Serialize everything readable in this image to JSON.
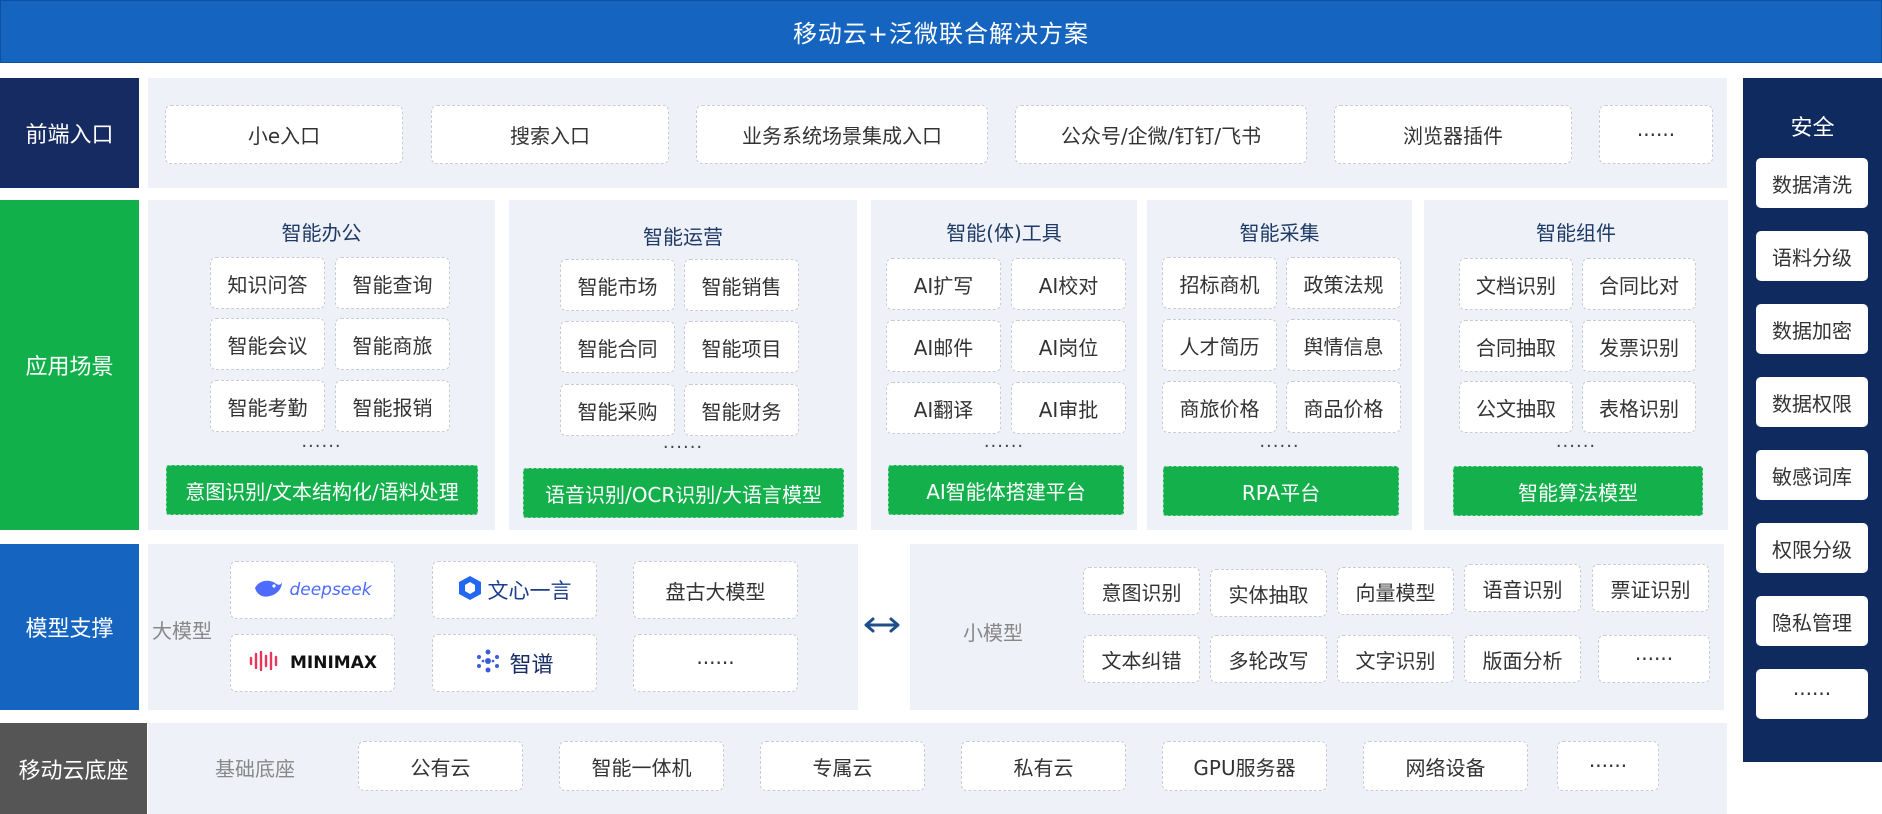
{
  "title": "移动云+泛微联合解决方案",
  "rows": {
    "frontend": {
      "label": "前端入口",
      "items": [
        "小e入口",
        "搜索入口",
        "业务系统场景集成入口",
        "公众号/企微/钉钉/飞书",
        "浏览器插件",
        "······"
      ]
    },
    "app": {
      "label": "应用场景",
      "groups": [
        {
          "title": "智能办公",
          "items": [
            "知识问答",
            "智能查询",
            "智能会议",
            "智能商旅",
            "智能考勤",
            "智能报销"
          ],
          "more": "······",
          "platform": "意图识别/文本结构化/语料处理"
        },
        {
          "title": "智能运营",
          "items": [
            "智能市场",
            "智能销售",
            "智能合同",
            "智能项目",
            "智能采购",
            "智能财务"
          ],
          "more": "······",
          "platform": "语音识别/OCR识别/大语言模型"
        },
        {
          "title": "智能(体)工具",
          "items": [
            "AI扩写",
            "AI校对",
            "AI邮件",
            "AI岗位",
            "AI翻译",
            "AI审批"
          ],
          "more": "······",
          "platform": "AI智能体搭建平台"
        },
        {
          "title": "智能采集",
          "items": [
            "招标商机",
            "政策法规",
            "人才简历",
            "舆情信息",
            "商旅价格",
            "商品价格"
          ],
          "more": "······",
          "platform": "RPA平台"
        },
        {
          "title": "智能组件",
          "items": [
            "文档识别",
            "合同比对",
            "合同抽取",
            "发票识别",
            "公文抽取",
            "表格识别"
          ],
          "more": "······",
          "platform": "智能算法模型"
        }
      ]
    },
    "model": {
      "label": "模型支撑",
      "large_label": "大模型",
      "large_models": [
        "deepseek",
        "文心一言",
        "盘古大模型",
        "MINIMAX",
        "智谱",
        "······"
      ],
      "small_label": "小模型",
      "small_models": [
        "意图识别",
        "实体抽取",
        "向量模型",
        "语音识别",
        "票证识别",
        "文本纠错",
        "多轮改写",
        "文字识别",
        "版面分析",
        "······"
      ]
    },
    "base": {
      "label": "移动云底座",
      "sub_label": "基础底座",
      "items": [
        "公有云",
        "智能一体机",
        "专属云",
        "私有云",
        "GPU服务器",
        "网络设备",
        "······"
      ]
    }
  },
  "security": {
    "title": "安全",
    "items": [
      "数据清洗",
      "语料分级",
      "数据加密",
      "数据权限",
      "敏感词库",
      "权限分级",
      "隐私管理",
      "······"
    ]
  },
  "colors": {
    "top": "#1565c0",
    "frontend": "#172b63",
    "app": "#12b04b",
    "model": "#1565c0",
    "base": "#555555",
    "security": "#0f2a5e",
    "panel": "#eef2f8"
  }
}
